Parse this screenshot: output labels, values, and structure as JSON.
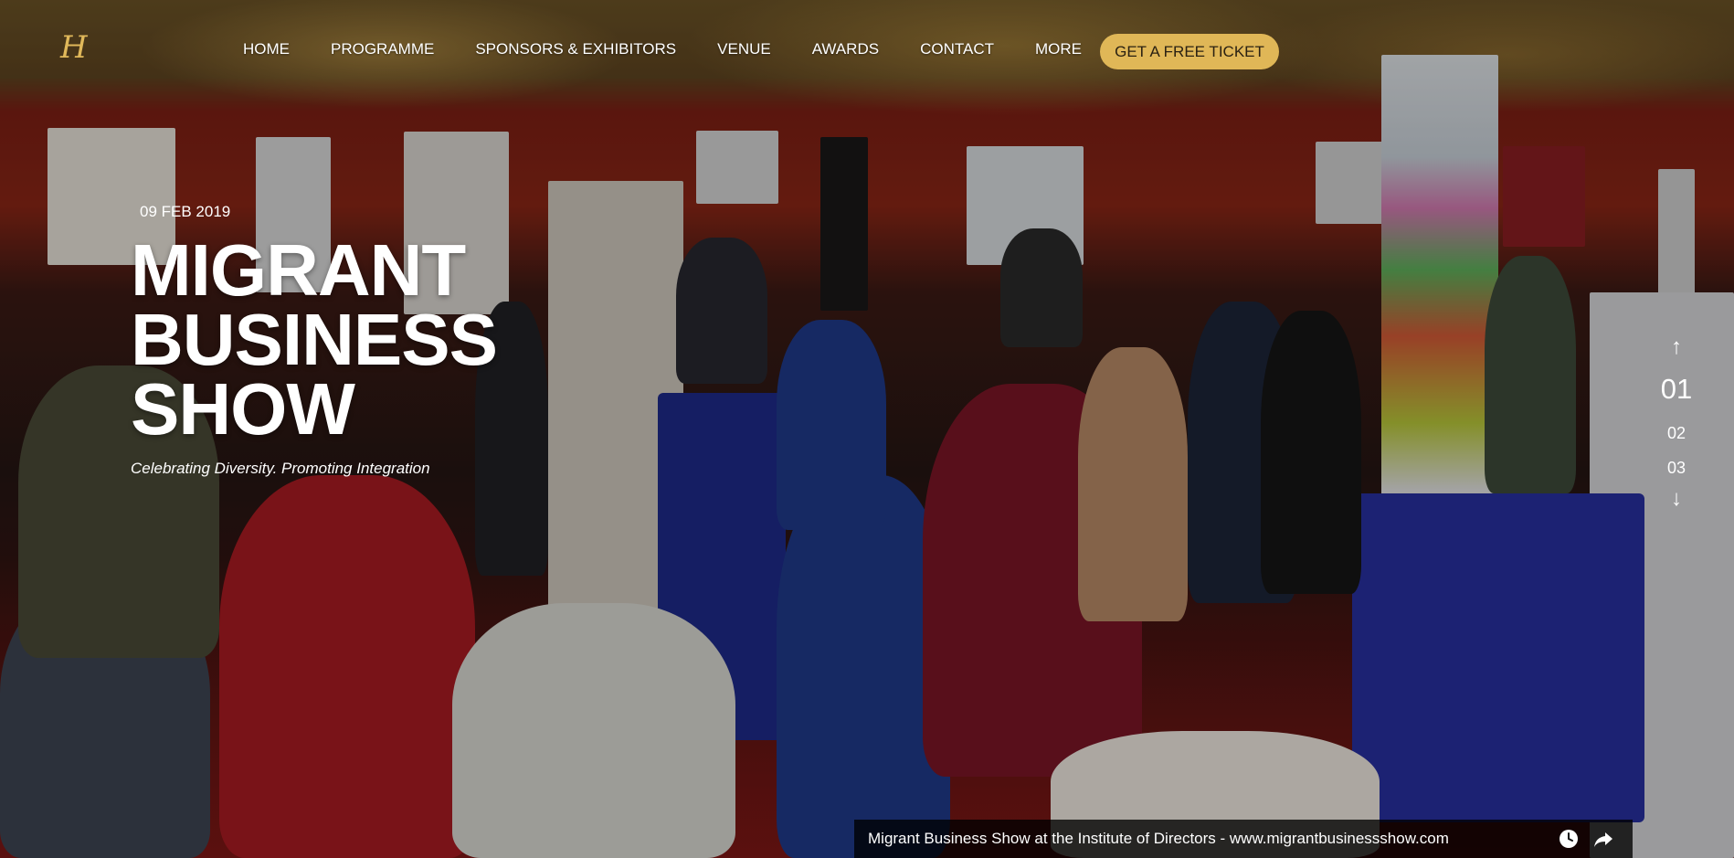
{
  "nav": {
    "logo_text": "H",
    "items": [
      "HOME",
      "PROGRAMME",
      "SPONSORS & EXHIBITORS",
      "VENUE",
      "AWARDS",
      "CONTACT",
      "MORE"
    ],
    "cta_label": "GET A FREE TICKET"
  },
  "hero": {
    "date": "09 FEB 2019",
    "title_lines": [
      "MIGRANT",
      "BUSINESS",
      "SHOW"
    ],
    "tagline": "Celebrating Diversity. Promoting Integration"
  },
  "pager": {
    "up_symbol": "↑",
    "down_symbol": "↓",
    "slides": [
      "01",
      "02",
      "03"
    ],
    "active": "01"
  },
  "video": {
    "title": "Migrant Business Show at the Institute of Directors - www.migrantbusinessshow.com",
    "icons": [
      "clock-icon",
      "share-icon"
    ]
  },
  "colors": {
    "accent": "#e0b757",
    "text": "#ffffff"
  }
}
